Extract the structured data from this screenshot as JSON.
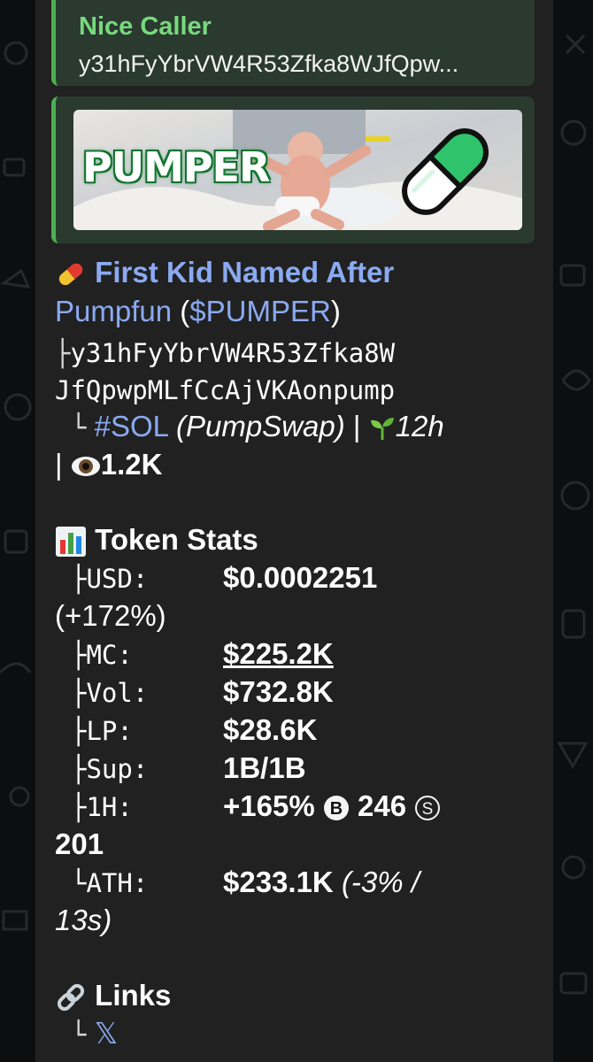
{
  "reply": {
    "title": "Nice Caller",
    "text": "y31hFyYbrVW4R53Zfka8WJfQpw..."
  },
  "preview": {
    "image_text": "PUMPER"
  },
  "header": {
    "title_line1": "First Kid Named After",
    "title_line2_name": "Pumpfun",
    "paren_open": " (",
    "ticker": "$PUMPER",
    "paren_close": ")",
    "address_prefix": "├",
    "address_part1": "y31hFyYbrVW4R53Zfka8W",
    "address_part2": "JfQpwpMLfCcAjVKAonpump",
    "chain_prefix": "└",
    "chain": "#SOL",
    "dex": "(PumpSwap)",
    "sep": "|",
    "age": "12h",
    "views_sep": "|",
    "views": "1.2K"
  },
  "stats": {
    "title": "Token Stats",
    "usd_label": "├USD:",
    "usd_value": "$0.0002251",
    "usd_change": "(+172%)",
    "mc_label": "├MC:",
    "mc_value": "$225.2K",
    "vol_label": "├Vol:",
    "vol_value": "$732.8K",
    "lp_label": "├LP:",
    "lp_value": "$28.6K",
    "sup_label": "├Sup:",
    "sup_value": "1B/1B",
    "h1_label": "├1H:",
    "h1_change": "+165%",
    "h1_buys": "246",
    "h1_sells": "201",
    "buy_symbol": "B",
    "sell_symbol": "S",
    "ath_label": "└ATH:",
    "ath_value": "$233.1K",
    "ath_note_1": "(-3% /",
    "ath_note_2": "13s)"
  },
  "links": {
    "title": "Links",
    "prefix": "└",
    "x_label": "𝕏"
  },
  "colors": {
    "accent_green": "#4caf50",
    "link_blue": "#8aaaf2",
    "bubble_bg": "#212121"
  }
}
